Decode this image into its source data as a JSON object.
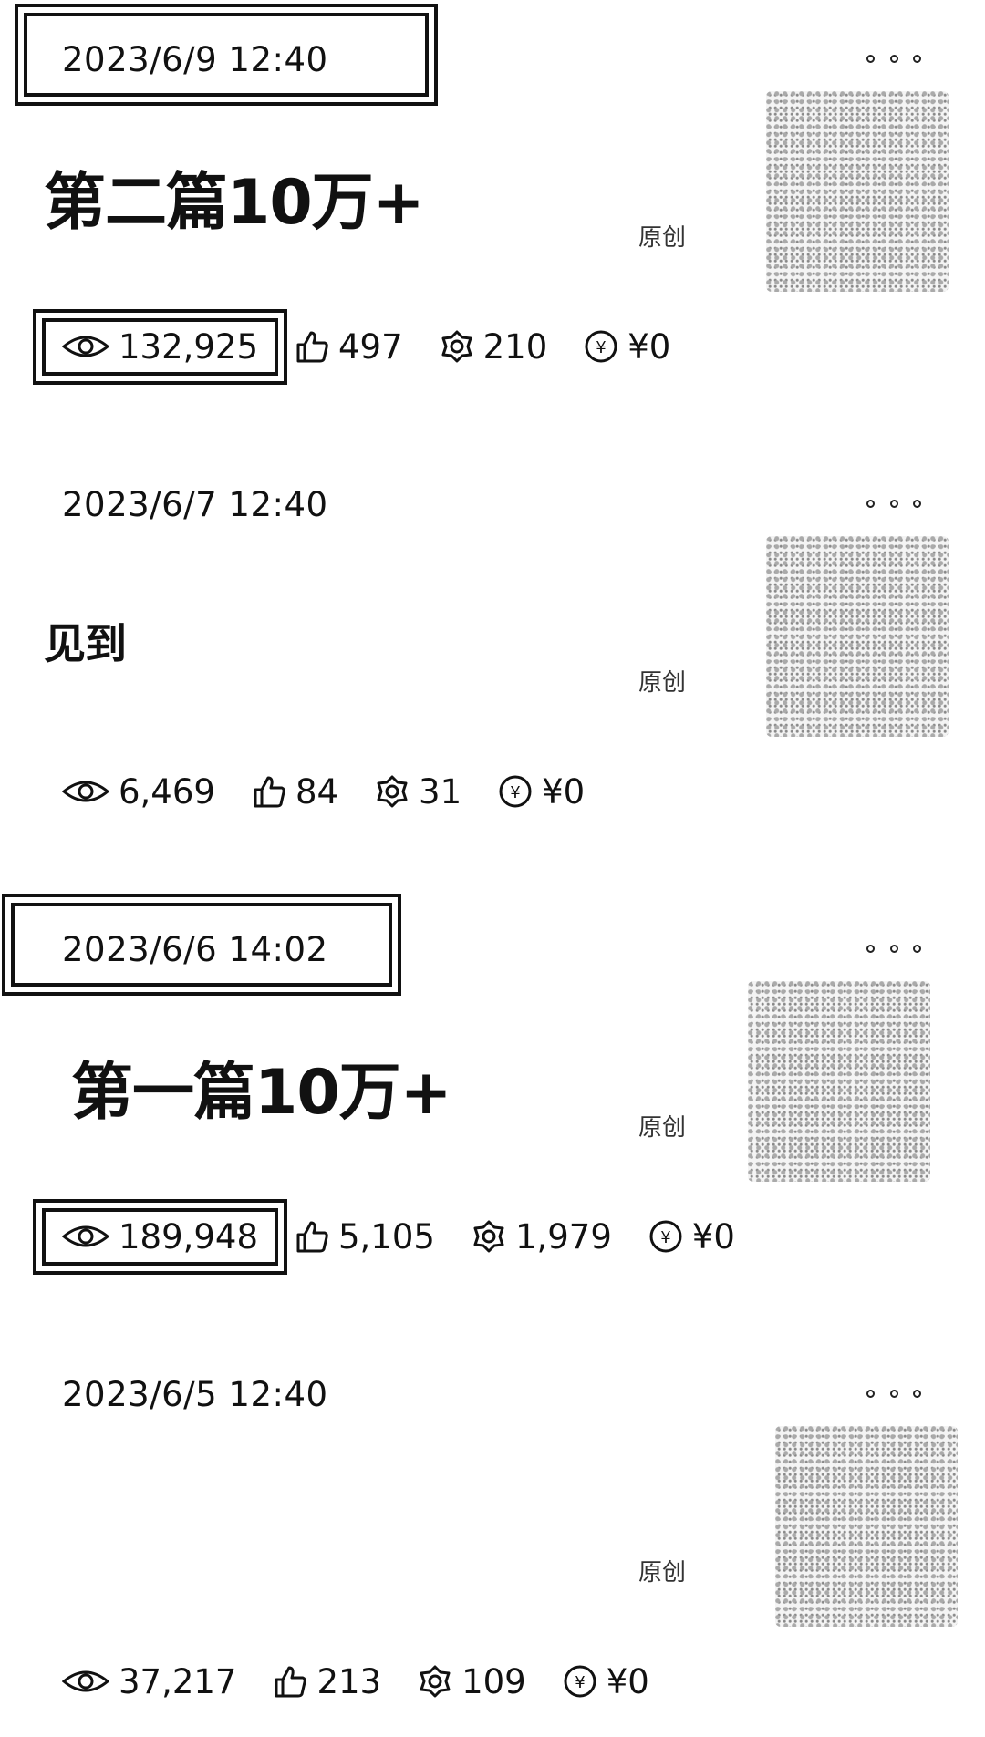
{
  "posts": [
    {
      "date": "2023/6/9 12:40",
      "title": "第二篇10万+",
      "original": "原创",
      "views": "132,925",
      "likes": "497",
      "shares": "210",
      "income": "¥0"
    },
    {
      "date": "2023/6/7 12:40",
      "title": "见到",
      "original": "原创",
      "views": "6,469",
      "likes": "84",
      "shares": "31",
      "income": "¥0"
    },
    {
      "date": "2023/6/6 14:02",
      "title": "第一篇10万+",
      "original": "原创",
      "views": "189,948",
      "likes": "5,105",
      "shares": "1,979",
      "income": "¥0"
    },
    {
      "date": "2023/6/5 12:40",
      "title": "",
      "original": "原创",
      "views": "37,217",
      "likes": "213",
      "shares": "109",
      "income": "¥0"
    }
  ],
  "icons": {
    "views": "eye-icon",
    "likes": "thumbs-up-icon",
    "shares": "share-icon",
    "income": "yuan-coin-icon",
    "more": "more-dots-icon"
  }
}
